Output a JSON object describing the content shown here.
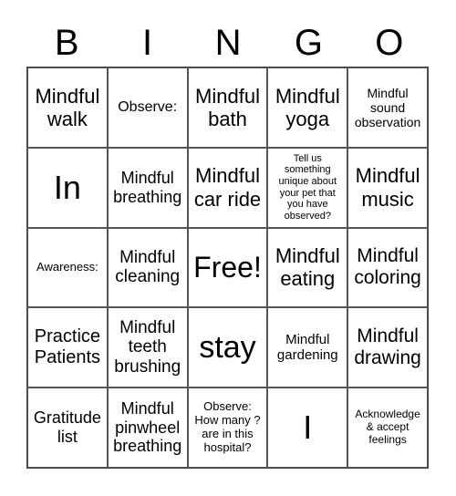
{
  "header": [
    "B",
    "I",
    "N",
    "G",
    "O"
  ],
  "cells": [
    "Mindful walk",
    "Observe:",
    "Mindful bath",
    "Mindful yoga",
    "Mindful sound observation",
    "In",
    "Mindful breathing",
    "Mindful car ride",
    "Tell us something unique about your pet that you have observed?",
    "Mindful music",
    "Awareness:",
    "Mindful cleaning",
    "Free!",
    "Mindful eating",
    "Mindful coloring",
    "Practice Patients",
    "Mindful teeth brushing",
    "stay",
    "Mindful gardening",
    "Mindful drawing",
    "Gratitude list",
    "Mindful pinwheel breathing",
    "Observe: How many ? are in this hospital?",
    "I",
    "Acknowledge & accept feelings"
  ]
}
